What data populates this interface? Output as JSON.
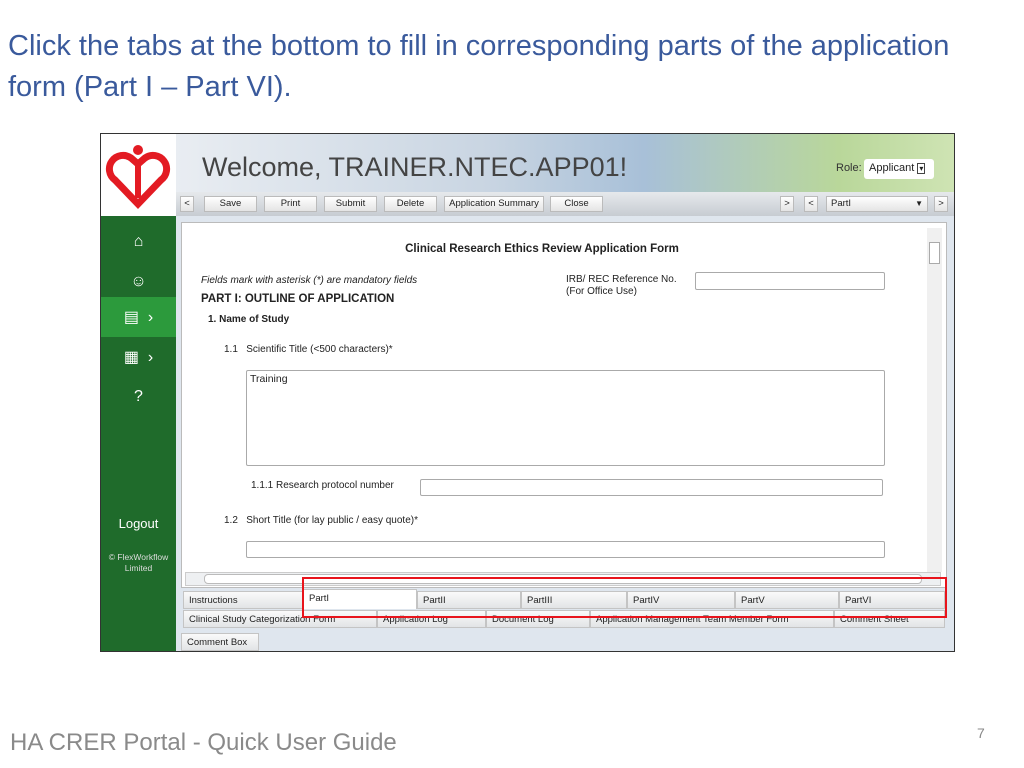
{
  "slide": {
    "title": "Click the tabs at the bottom to fill in corresponding parts of the application form (Part I – Part VI).",
    "footer": "HA CRER Portal - Quick User Guide",
    "page_number": "7"
  },
  "header": {
    "welcome": "Welcome, TRAINER.NTEC.APP01!",
    "role_label": "Role:",
    "role_value": "Applicant"
  },
  "toolbar": {
    "prev": "<",
    "buttons": [
      "Save",
      "Print",
      "Submit",
      "Delete",
      "Application Summary",
      "Close"
    ],
    "next": ">",
    "part_prev": "<",
    "part_select": "PartI",
    "part_next": ">"
  },
  "sidebar": {
    "items": [
      "home-icon",
      "user-icon",
      "clipboard-icon",
      "grid-icon",
      "help-icon"
    ],
    "logout": "Logout",
    "copyright": "© FlexWorkflow Limited"
  },
  "form": {
    "title": "Clinical Research Ethics Review Application Form",
    "mandatory_note": "Fields mark with asterisk (*) are mandatory fields",
    "part_heading": "PART I: OUTLINE OF APPLICATION",
    "section": "1. Name of Study",
    "irb_label": "IRB/ REC Reference No.",
    "irb_sub": "(For Office Use)",
    "irb_value": "",
    "q1_1": "1.1   Scientific Title (<500 characters)*",
    "q1_1_value": "Training",
    "q1_1_1": "1.1.1 Research protocol number",
    "q1_1_1_value": "",
    "q1_2": "1.2   Short Title (for lay public / easy quote)*",
    "q1_2_value": ""
  },
  "tabs": {
    "row1": [
      "Instructions",
      "PartI",
      "PartII",
      "PartIII",
      "PartIV",
      "PartV",
      "PartVI"
    ],
    "row2": [
      "Clinical Study Categorization Form",
      "Application Log",
      "Document Log",
      "Application Management Team Member Form",
      "Comment Sheet"
    ],
    "row3": [
      "Comment Box"
    ],
    "selected": "PartI"
  },
  "colors": {
    "sidebar": "#1f6b2b",
    "sidebar_active": "#2c9a3c",
    "highlight": "#e8141c",
    "title": "#3a5a9c"
  }
}
